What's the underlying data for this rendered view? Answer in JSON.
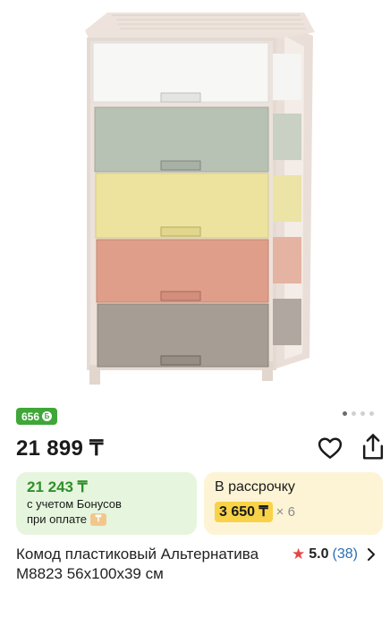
{
  "product": {
    "bonus_badge": "656",
    "bonus_badge_icon": "bonus-coin-icon",
    "price": "21 899 ₸",
    "title": "Комод пластиковый Альтернатива М8823 56х100х39 см"
  },
  "gallery": {
    "dot_count": 4,
    "active_index": 0
  },
  "bonus_card": {
    "amount": "21 243 ₸",
    "line1": "с учетом Бонусов",
    "line2": "при оплате"
  },
  "installment_card": {
    "title": "В рассрочку",
    "price": "3 650 ₸",
    "multiplier": "× 6"
  },
  "rating": {
    "score": "5.0",
    "count": "(38)"
  },
  "colors": {
    "bonus_green": "#3fa638",
    "bonus_card_bg": "#e6f5dd",
    "installment_bg": "#fdf4d6",
    "installment_price_bg": "#f8d247",
    "star": "#e64646",
    "link_blue": "#2a6fb3"
  }
}
